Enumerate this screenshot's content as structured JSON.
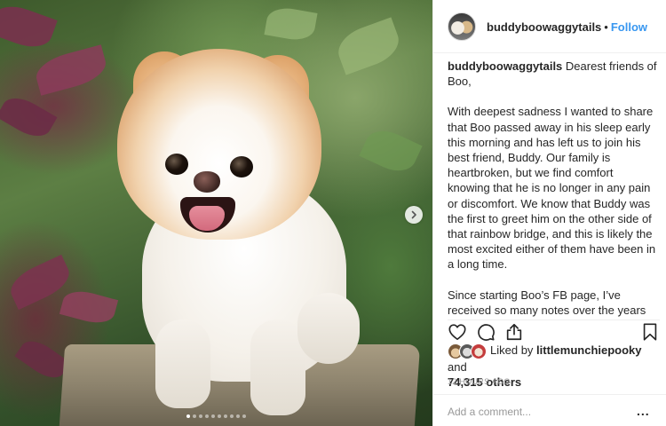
{
  "post": {
    "username": "buddyboowaggytails",
    "header_separator": "•",
    "follow_label": "Follow",
    "image_alt": "Boo the Pomeranian standing on a stone ledge",
    "carousel": {
      "total_slides": 10,
      "active_index": 0
    }
  },
  "caption": {
    "username": "buddyboowaggytails",
    "paragraphs": [
      "Dearest friends of Boo,",
      "With deepest sadness I wanted to share that Boo passed away in his sleep early this morning and has left us to join his best friend, Buddy. Our family is heartbroken, but we find comfort knowing that he is no longer in any pain or discomfort. We know that Buddy was the first to greet him on the other side of that rainbow bridge, and this is likely the most excited either of them have been in a long time.",
      "Since starting Boo’s FB page, I’ve received so many notes over the years from people sharing stories of how Boo brightened their days and helped bring a little light to their lives during difficult times. And that was really the purpose of all this. Boo brought"
    ]
  },
  "actions": {
    "like_icon": "heart-icon",
    "comment_icon": "comment-bubble-icon",
    "share_icon": "share-icon",
    "save_icon": "bookmark-icon"
  },
  "likes": {
    "prefix": "Liked by",
    "user": "littlemunchiepooky",
    "conjunction": "and",
    "count_text": "74,315 others"
  },
  "timestamp": "12 HOURS AGO",
  "comment": {
    "placeholder": "Add a comment...",
    "more_label": "..."
  },
  "colors": {
    "link_blue": "#3897f0",
    "text": "#262626",
    "muted": "#999999",
    "border": "#efefef"
  }
}
